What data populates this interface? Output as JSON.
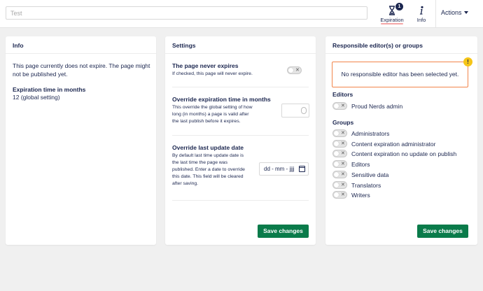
{
  "header": {
    "name_value": "Test",
    "apps": [
      {
        "label": "Expiration",
        "badge": "1",
        "icon": "hourglass-icon",
        "active": true
      },
      {
        "label": "Info",
        "icon": "info-icon",
        "active": false
      }
    ],
    "actions_label": "Actions"
  },
  "info_panel": {
    "title": "Info",
    "message": "This page currently does not expire. The page might not be published yet.",
    "expiration_label": "Expiration time in months",
    "expiration_value": "12 (global setting)"
  },
  "settings_panel": {
    "title": "Settings",
    "never_expires": {
      "label": "The page never expires",
      "description": "If checked, this page will never expire."
    },
    "override_expiration": {
      "label": "Override expiration time in months",
      "description": "This override the global setting of how long (in months) a page is valid after the last publish before it expires."
    },
    "override_update": {
      "label": "Override last update date",
      "description": "By default last time update date is the last time the page was published. Enter a date to override this date. This field will be cleared after saving.",
      "date_placeholder": "dd - mm - jjjj"
    },
    "save_label": "Save changes"
  },
  "responsible_panel": {
    "title": "Responsible editor(s) or groups",
    "warning": "No responsible editor has been selected yet.",
    "warning_icon": "!",
    "editors_heading": "Editors",
    "editors": [
      "Proud Nerds admin"
    ],
    "groups_heading": "Groups",
    "groups": [
      "Administrators",
      "Content expiration administrator",
      "Content expiration no update on publish",
      "Editors",
      "Sensitive data",
      "Translators",
      "Writers"
    ],
    "save_label": "Save changes"
  },
  "colors": {
    "text": "#1b264f",
    "save_button": "#0a7b4a",
    "warning_border": "#f2854a",
    "warning_badge": "#f5c518"
  }
}
